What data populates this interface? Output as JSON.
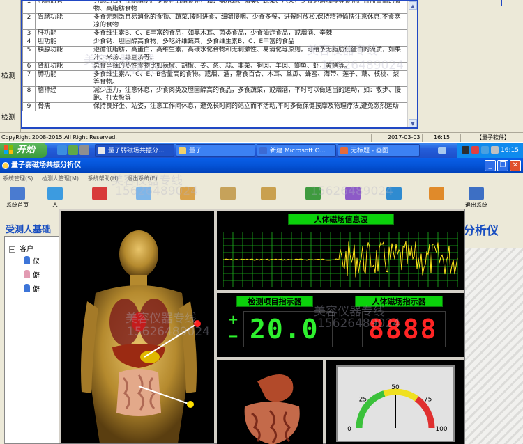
{
  "top_window": {
    "left_labels": [
      "检测",
      "检测"
    ],
    "table_rows": [
      {
        "n": "1",
        "name": "心脑血管",
        "advice": "劳逸结合，控制脂肪。多食粗血脂食物，如：黑木耳、菌类、蔬菜、水果，少食速溶咖啡等食物。含盖量高的食物、高脂肪食物"
      },
      {
        "n": "2",
        "name": "胃肠功能",
        "advice": "多食无刺激且易消化的食物、蔬菜,按时进食，细嚼慢咽、少食多餐，进餐时放松,保持精神愉快注意休息,不食寒凉的食物"
      },
      {
        "n": "3",
        "name": "肝功能",
        "advice": "多食维生素B、C、E丰富的食品，如黑木耳、菌类食品，少食油炸食品，戒烟酒、辛辣"
      },
      {
        "n": "4",
        "name": "胆功能",
        "advice": "少食钙、胆固醇高食物，多吃纤维蔬菜，多食维生素B、C、E丰富的食品"
      },
      {
        "n": "5",
        "name": "胰腺功能",
        "advice": "遵循低脂肪，高蛋白，高维生素，高碳水化合物和无刺激性、易消化等原则。可给予无脂肪低蛋白的流质，如果汁、米汤、绿豆汤等。"
      },
      {
        "n": "6",
        "name": "肾脏功能",
        "advice": "忌食辛辣的热性食物比如辣椒、胡椒、姜、葱、蒜、韭菜、狗肉、羊肉、鲫鱼、虾，黄鳝等。"
      },
      {
        "n": "7",
        "name": "肺功能",
        "advice": "多食维生素A、C、E、B含量高的食物。戒烟、酒，常食百合、木耳、丝瓜、蜂蜜、海带、莲子、藕、核桃、梨等食物。"
      },
      {
        "n": "8",
        "name": "脑神经",
        "advice": "减少压力，注意休息，少食肉类及胆固醇高的食品，多食蔬菜，戒烟酒，平时可以做适当的运动，如：散步、慢跑、打太极等"
      },
      {
        "n": "9",
        "name": "骨病",
        "advice": "保持良好坐、站姿，注意工作间休息，避免长时间的站立而不活动,平时多做保健按摩及物理疗法,避免激烈运动"
      }
    ],
    "status": {
      "copyright": "CopyRight 2008-2015,All Right Reserved.",
      "date": "2017-03-03",
      "time": "16:15",
      "brand": "【量子软件】"
    }
  },
  "taskbar": {
    "start_label": "开始",
    "tasks": [
      "量子弱磁场共振分...",
      "量子",
      "新建 Microsoft O...",
      "无标题 - 画图"
    ],
    "clock": "16:15"
  },
  "app": {
    "title": "量子弱磁场共振分析仪",
    "menu": [
      "系统管理(S)",
      "检测人管理(M)",
      "系统帮助(H)",
      "退出系统(E)"
    ],
    "toolbar": [
      {
        "label": "系统首页",
        "color": "#4a7bd0"
      },
      {
        "label": "人",
        "color": "#3c9be0"
      },
      {
        "label": "",
        "color": "#d83a3a"
      },
      {
        "label": "",
        "color": "#7fb6e8"
      },
      {
        "label": "",
        "color": "#d9a24a"
      },
      {
        "label": "",
        "color": "#c6a25a"
      },
      {
        "label": "",
        "color": "#c9a04f"
      },
      {
        "label": "",
        "color": "#3f9a3f"
      },
      {
        "label": "",
        "color": "#8d5ac7"
      },
      {
        "label": "",
        "color": "#2f8bd0"
      },
      {
        "label": "",
        "color": "#e08a2a"
      },
      {
        "label": "退出系统",
        "color": "#3d6fc4"
      }
    ],
    "tested_label": "受测人基础",
    "analyzer_label": "分析仪",
    "tree": {
      "root": "客户",
      "items": [
        "仪",
        "僻",
        "僻"
      ]
    }
  },
  "analysis": {
    "wave_title": "人体磁场信息波",
    "indicator_title_left": "检测项目指示器",
    "indicator_title_right": "人体磁场指示器",
    "indicator_value": "20.0",
    "indicator_right_value": "8888",
    "plus": "+",
    "minus": "−",
    "gauge_ticks": [
      "0",
      "25",
      "50",
      "75",
      "100"
    ],
    "gauge_value": 50,
    "colors": {
      "segment_green": "#2ef02e",
      "segment_red": "#ff2424",
      "wave": "#ffe61a",
      "grid": "#1db81d"
    }
  },
  "watermarks": [
    "美容仪器专线",
    "15626489024"
  ]
}
